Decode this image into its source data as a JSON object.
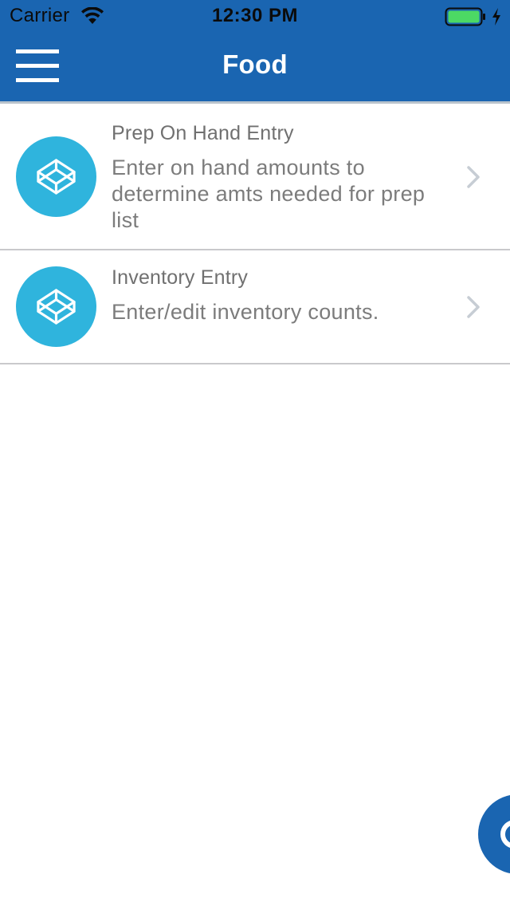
{
  "status_bar": {
    "carrier": "Carrier",
    "time": "12:30 PM",
    "battery_level": 1.0,
    "charging": true,
    "wifi_icon": "wifi-icon",
    "battery_icon": "battery-icon"
  },
  "nav": {
    "title": "Food",
    "menu_icon": "hamburger-menu-icon"
  },
  "list": {
    "items": [
      {
        "title": "Prep On Hand Entry",
        "description": "Enter on hand amounts to determine amts needed for prep list",
        "icon": "codepen-cube-icon"
      },
      {
        "title": "Inventory Entry",
        "description": "Enter/edit inventory counts.",
        "icon": "codepen-cube-icon"
      }
    ]
  },
  "fab": {
    "icon": "circle-action-icon"
  },
  "colors": {
    "primary": "#1a65b1",
    "icon_bg": "#2fb4dd",
    "text_gray": "#707070",
    "divider": "#c9c9cc",
    "chevron": "#c7cdd4",
    "battery_green": "#4cd964"
  }
}
